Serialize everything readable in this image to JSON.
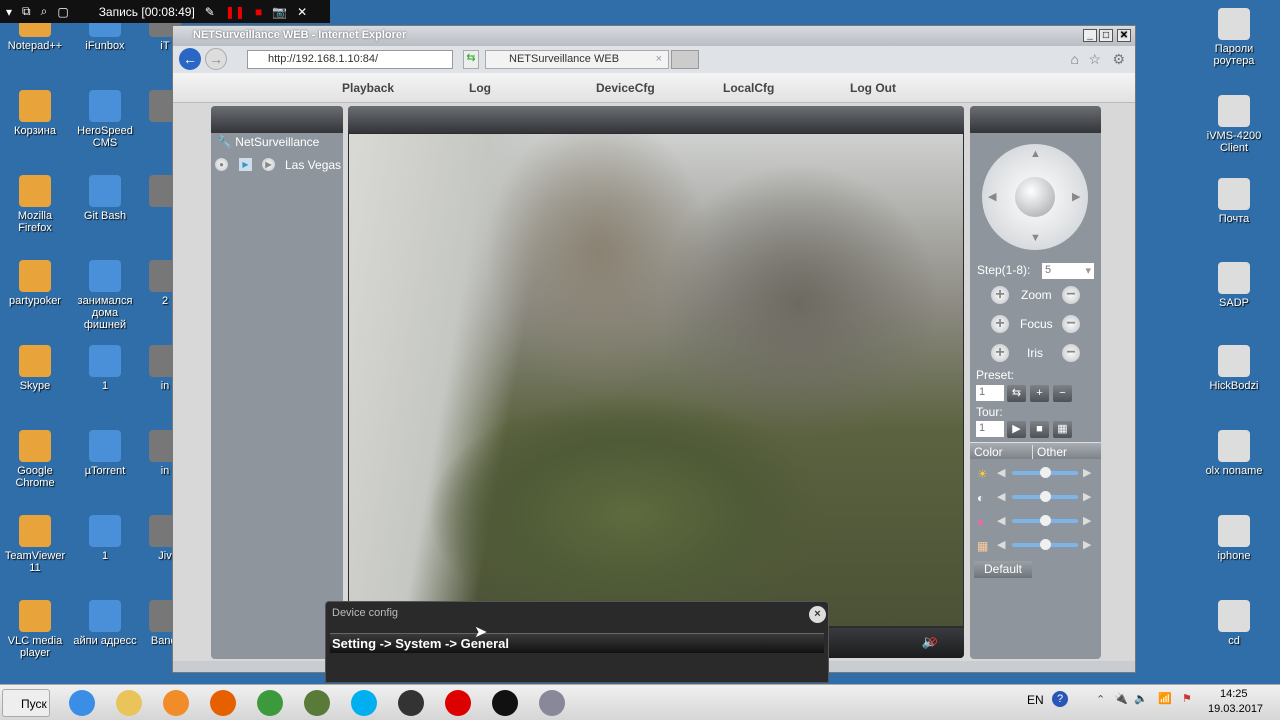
{
  "recorder": {
    "title": "Запись [00:08:49]"
  },
  "desktop": {
    "left_col": [
      "Notepad++",
      "Корзина",
      "Mozilla Firefox",
      "partypoker",
      "Skype",
      "Google Chrome",
      "TeamViewer 11",
      "VLC media player"
    ],
    "mid_col": [
      "iFunbox",
      "HeroSpeed CMS",
      "Git Bash",
      "занимался дома фишней",
      "1",
      "µTorrent",
      "1",
      "айпи адресс"
    ],
    "third_col": [
      "iT",
      "",
      "",
      "2",
      "in",
      "in",
      "Jiv",
      "Bandi"
    ],
    "right_col": [
      "Пароли роутера",
      "iVMS-4200 Client",
      "Почта",
      "SADP",
      "HickBodzi",
      "olx noname",
      "iphone",
      "cd"
    ]
  },
  "browser": {
    "title": "NETSurveillance WEB - Internet Explorer",
    "url": "http://192.168.1.10:84/",
    "tab": "NETSurveillance WEB"
  },
  "menu": [
    "Playback",
    "Log",
    "DeviceCfg",
    "LocalCfg",
    "Log Out"
  ],
  "tree": {
    "root": "NetSurveillance",
    "device": "Las Vegas"
  },
  "ptz": {
    "step_label": "Step(1-8):",
    "step_value": "5",
    "zoom": "Zoom",
    "focus": "Focus",
    "iris": "Iris",
    "preset_label": "Preset:",
    "preset_value": "1",
    "tour_label": "Tour:",
    "tour_value": "1",
    "tabs": [
      "Color",
      "Other"
    ],
    "sliders": [
      {
        "name": "brightness",
        "value": 0.5
      },
      {
        "name": "contrast",
        "value": 0.5
      },
      {
        "name": "saturation",
        "value": 0.5
      },
      {
        "name": "hue",
        "value": 0.5
      }
    ],
    "default": "Default"
  },
  "dialog": {
    "title": "Device config",
    "path": "Setting -> System -> General"
  },
  "taskbar": {
    "start": "Пуск",
    "lang": "EN",
    "time": "14:25",
    "date": "19.03.2017"
  }
}
